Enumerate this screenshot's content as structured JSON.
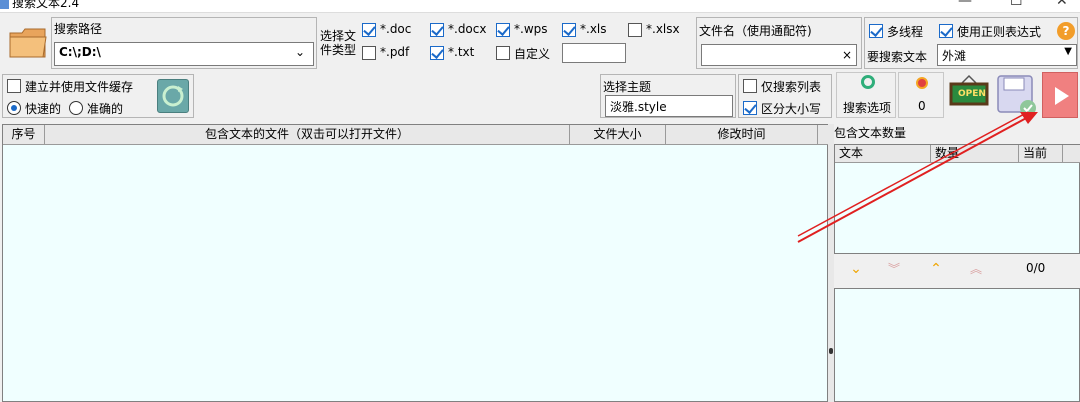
{
  "window": {
    "title": "搜索文本2.4",
    "min": "—",
    "max": "☐",
    "close": "✕"
  },
  "path_group": {
    "label": "搜索路径",
    "value": "C:\\;D:\\"
  },
  "filetype_group": {
    "label": "选择文件类型",
    "types": [
      {
        "label": "*.doc",
        "checked": true
      },
      {
        "label": "*.docx",
        "checked": true
      },
      {
        "label": "*.wps",
        "checked": true
      },
      {
        "label": "*.xls",
        "checked": true
      },
      {
        "label": "*.xlsx",
        "checked": false
      },
      {
        "label": "*.pdf",
        "checked": false
      },
      {
        "label": "*.txt",
        "checked": true
      },
      {
        "label": "自定义",
        "checked": false
      }
    ],
    "custom_value": ""
  },
  "filename_group": {
    "label": "文件名（使用通配符)",
    "value": "",
    "clear": "×"
  },
  "options_group": {
    "multithread": "多线程",
    "regex": "使用正则表达式",
    "help": "?",
    "search_text_label": "要搜索文本",
    "search_text_value": "外滩"
  },
  "cache_group": {
    "build_cache": "建立并使用文件缓存",
    "fast": "快速的",
    "accurate": "准确的"
  },
  "theme_group": {
    "label": "选择主题",
    "value": "淡雅.style"
  },
  "list_opts": {
    "only_list": "仅搜索列表",
    "case_sensitive": "区分大小写"
  },
  "toolbar": {
    "search_options": "搜索选项",
    "counter": "0",
    "open_label": "OPEN"
  },
  "results_table": {
    "columns": [
      "序号",
      "包含文本的文件（双击可以打开文件）",
      "文件大小",
      "修改时间"
    ]
  },
  "right_panel": {
    "title": "包含文本数量",
    "columns": [
      "文本",
      "数量",
      "当前"
    ],
    "nav_count": "0/0"
  },
  "colors": {
    "pane_bg": "#f0ffff",
    "accent": "#1b6ac9",
    "arrow": "#e02020"
  }
}
